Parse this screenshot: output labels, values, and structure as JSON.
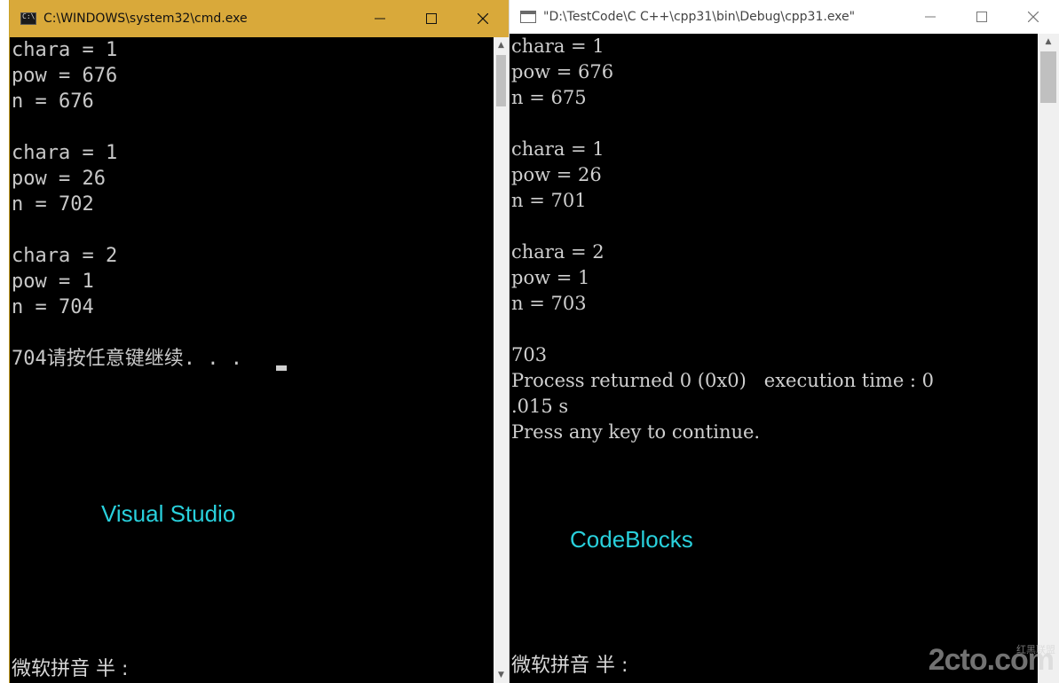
{
  "left_window": {
    "title": "C:\\WINDOWS\\system32\\cmd.exe",
    "output_lines": [
      "chara = 1",
      "pow = 676",
      "n = 676",
      "",
      "chara = 1",
      "pow = 26",
      "n = 702",
      "",
      "chara = 2",
      "pow = 1",
      "n = 704",
      "",
      "704请按任意键继续. . . "
    ],
    "overlay_label": "Visual Studio",
    "ime_status": "微软拼音 半 :"
  },
  "right_window": {
    "title": "\"D:\\TestCode\\C C++\\cpp31\\bin\\Debug\\cpp31.exe\"",
    "output_lines": [
      "chara = 1",
      "pow = 676",
      "n = 675",
      "",
      "chara = 1",
      "pow = 26",
      "n = 701",
      "",
      "chara = 2",
      "pow = 1",
      "n = 703",
      "",
      "703",
      "Process returned 0 (0x0)   execution time : 0",
      ".015 s",
      "Press any key to continue."
    ],
    "overlay_label": "CodeBlocks",
    "ime_status": "微软拼音 半 :"
  },
  "watermark": {
    "text": "2cto.com",
    "subtext": "红黑联盟"
  },
  "colors": {
    "cmd_titlebar": "#d9a93a",
    "console_bg": "#000000",
    "console_text": "#c8c8c8",
    "label_cyan": "#29d0dc"
  }
}
